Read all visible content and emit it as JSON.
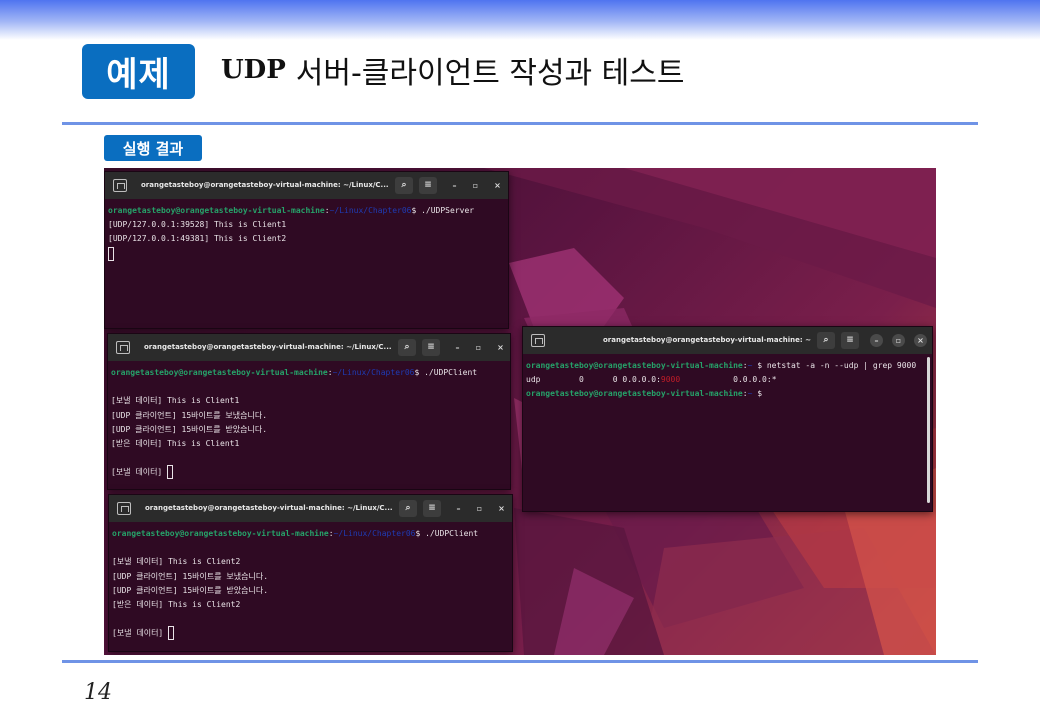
{
  "header": {
    "badge": "예제",
    "title_prefix": "UDP",
    "title_rest": "서버-클라이언트 작성과 테스트"
  },
  "result_tag": "실행 결과",
  "page_number": "14",
  "terminals": [
    {
      "title": "orangetasteboy@orangetasteboy-virtual-machine: ~/Linux/C...",
      "prompt_user": "orangetasteboy@orangetasteboy-virtual-machine",
      "prompt_path": "~/Linux/Chapter06",
      "command": "$ ./UDPServer",
      "output": [
        "[UDP/127.0.0.1:39528] This is Client1",
        "[UDP/127.0.0.1:49381] This is Client2"
      ]
    },
    {
      "title": "orangetasteboy@orangetasteboy-virtual-machine: ~/Linux/C...",
      "prompt_user": "orangetasteboy@orangetasteboy-virtual-machine",
      "prompt_path": "~/Linux/Chapter06",
      "command": "$ ./UDPClient",
      "output": [
        "",
        "[보낼 데이터] This is Client1",
        "[UDP 클라이언트] 15바이트를 보냈습니다.",
        "[UDP 클라이언트] 15바이트를 받았습니다.",
        "[받은 데이터] This is Client1",
        "",
        "[보낼 데이터] "
      ]
    },
    {
      "title": "orangetasteboy@orangetasteboy-virtual-machine: ~/Linux/C...",
      "prompt_user": "orangetasteboy@orangetasteboy-virtual-machine",
      "prompt_path": "~/Linux/Chapter06",
      "command": "$ ./UDPClient",
      "output": [
        "",
        "[보낼 데이터] This is Client2",
        "[UDP 클라이언트] 15바이트를 보냈습니다.",
        "[UDP 클라이언트] 15바이트를 받았습니다.",
        "[받은 데이터] This is Client2",
        "",
        "[보낼 데이터] "
      ]
    },
    {
      "title": "orangetasteboy@orangetasteboy-virtual-machine: ~",
      "prompt_user": "orangetasteboy@orangetasteboy-virtual-machine",
      "prompt_path": "~",
      "command": "$ netstat -a -n --udp | grep 9000",
      "netstat_row": {
        "proto": "udp",
        "recv": "0",
        "send": "0",
        "local_prefix": "0.0.0.0:",
        "local_port": "9000",
        "foreign": "0.0.0.0:*"
      },
      "final_prompt": "$"
    }
  ],
  "icons": {
    "tab": "new-tab-icon",
    "search": "search-icon",
    "menu": "hamburger-menu-icon",
    "minimize": "minimize-icon",
    "maximize": "maximize-icon",
    "close": "close-icon"
  },
  "colors": {
    "badge": "#0a6ec0",
    "rule": "#6f93e6",
    "terminal_bg": "#2f0a23",
    "prompt_user": "#26a269",
    "prompt_path": "#1f3bb3",
    "port_highlight": "#c01c28"
  }
}
